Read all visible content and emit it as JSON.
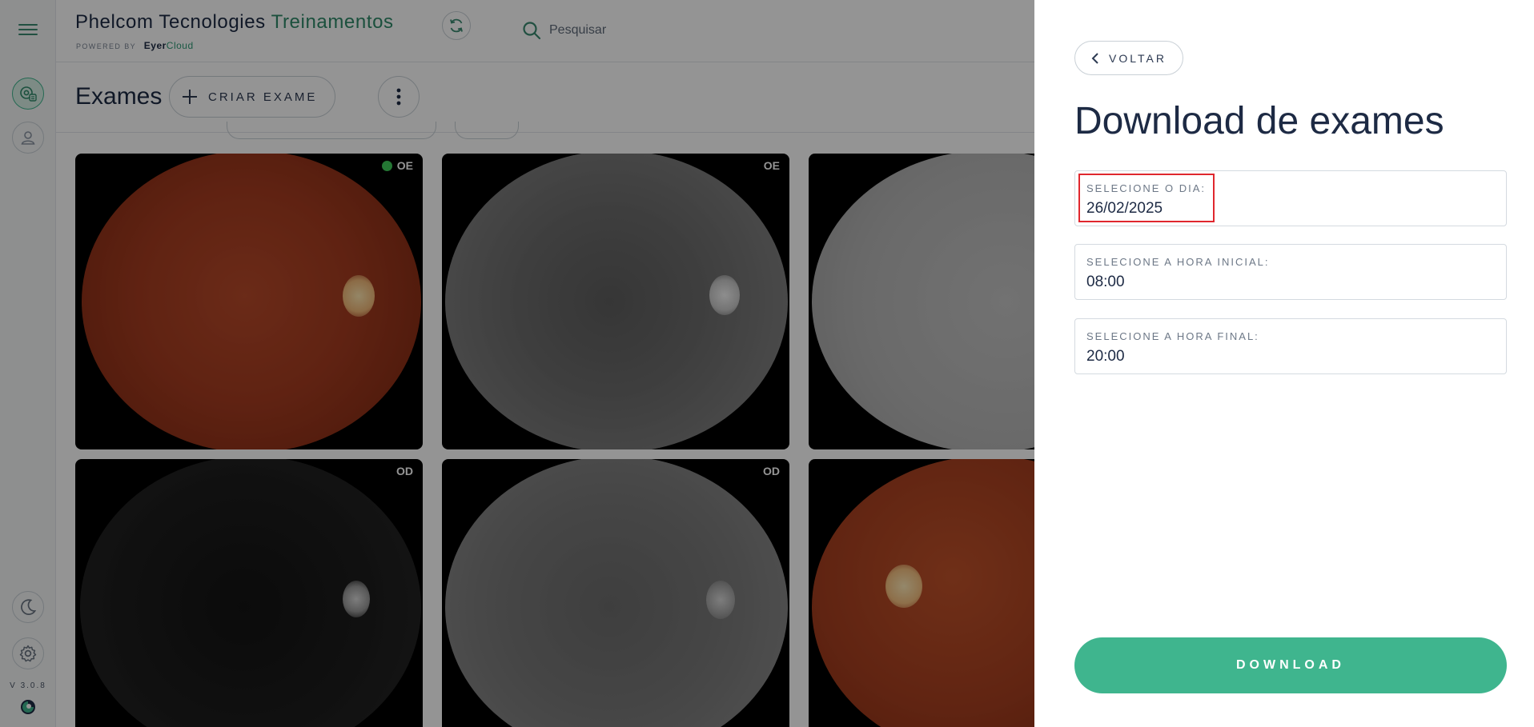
{
  "app": {
    "brand_main": "Phelcom Tecnologies",
    "brand_accent": " Treinamentos",
    "powered_label": "POWERED BY",
    "powered_brand_main": "Eyer",
    "powered_brand_accent": "Cloud",
    "version": "V 3.0.8"
  },
  "search": {
    "placeholder": "Pesquisar"
  },
  "exams": {
    "title": "Exames",
    "create_label": "CRIAR EXAME",
    "cards": [
      {
        "eye": "OE",
        "style": "color",
        "status_dot": true
      },
      {
        "eye": "OE",
        "style": "gray",
        "status_dot": false
      },
      {
        "eye": "",
        "style": "light",
        "status_dot": false
      },
      {
        "eye": "OD",
        "style": "dark",
        "status_dot": false
      },
      {
        "eye": "OD",
        "style": "mid",
        "status_dot": false
      },
      {
        "eye": "",
        "style": "color2",
        "status_dot": false
      }
    ]
  },
  "panel": {
    "back_label": "VOLTAR",
    "title": "Download de exames",
    "fields": [
      {
        "label": "SELECIONE O DIA:",
        "value": "26/02/2025"
      },
      {
        "label": "SELECIONE A HORA INICIAL:",
        "value": "08:00"
      },
      {
        "label": "SELECIONE A HORA FINAL:",
        "value": "20:00"
      }
    ],
    "download_label": "DOWNLOAD"
  },
  "colors": {
    "accent": "#3fb58e",
    "brand_text": "#1d2a44",
    "highlight": "#e0272e",
    "status_dot": "#3fce5a"
  }
}
